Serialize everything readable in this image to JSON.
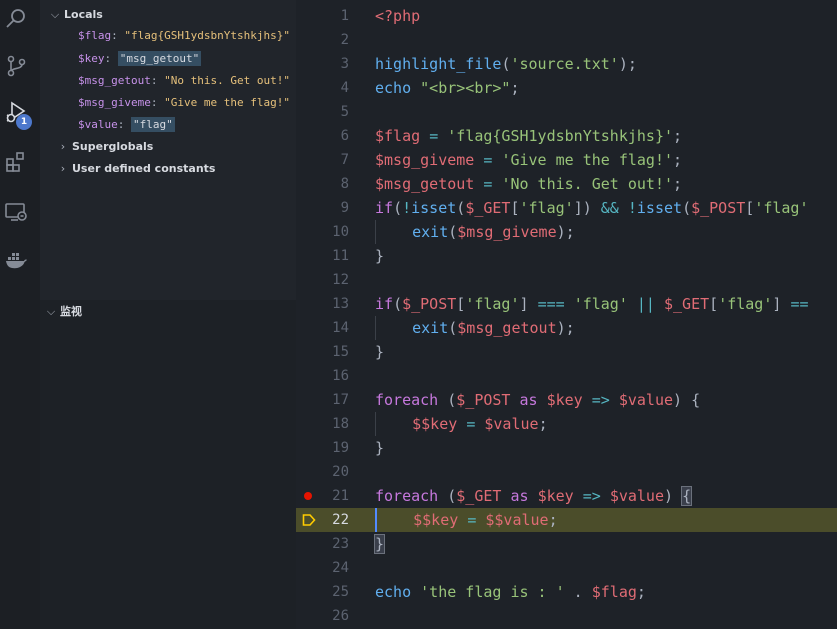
{
  "activity_bar": {
    "icons": [
      "search-icon",
      "source-control-icon",
      "run-debug-icon",
      "extensions-icon",
      "remote-explorer-icon",
      "docker-icon"
    ],
    "debug_badge": "1"
  },
  "sidebar": {
    "locals_label": "Locals",
    "locals": [
      {
        "name": "$flag",
        "value": "\"flag{GSH1ydsbnYtshkjhs}\"",
        "highlight": false
      },
      {
        "name": "$key",
        "value": "\"msg_getout\"",
        "highlight": true
      },
      {
        "name": "$msg_getout",
        "value": "\"No this. Get out!\"",
        "highlight": false
      },
      {
        "name": "$msg_giveme",
        "value": "\"Give me the flag!\"",
        "highlight": false
      },
      {
        "name": "$value",
        "value": "\"flag\"",
        "highlight": true
      }
    ],
    "superglobals_label": "Superglobals",
    "constants_label": "User defined constants",
    "watch_label": "监视"
  },
  "editor": {
    "breakpoint_line": 21,
    "current_line": 22,
    "line_numbers": [
      "1",
      "2",
      "3",
      "4",
      "5",
      "6",
      "7",
      "8",
      "9",
      "10",
      "11",
      "12",
      "13",
      "14",
      "15",
      "16",
      "17",
      "18",
      "19",
      "20",
      "21",
      "22",
      "23",
      "24",
      "25",
      "26"
    ],
    "lines": [
      [
        [
          "tag",
          "<?php"
        ]
      ],
      [],
      [
        [
          "fn",
          "highlight_file"
        ],
        [
          "pt",
          "("
        ],
        [
          "str",
          "'source.txt'"
        ],
        [
          "pt",
          ");"
        ]
      ],
      [
        [
          "fn",
          "echo"
        ],
        [
          "pt",
          " "
        ],
        [
          "str",
          "\"<br><br>\""
        ],
        [
          "pt",
          ";"
        ]
      ],
      [],
      [
        [
          "var",
          "$flag"
        ],
        [
          "pt",
          " "
        ],
        [
          "op",
          "="
        ],
        [
          "pt",
          " "
        ],
        [
          "str",
          "'flag{GSH1ydsbnYtshkjhs}'"
        ],
        [
          "pt",
          ";"
        ]
      ],
      [
        [
          "var",
          "$msg_giveme"
        ],
        [
          "pt",
          " "
        ],
        [
          "op",
          "="
        ],
        [
          "pt",
          " "
        ],
        [
          "str",
          "'Give me the flag!'"
        ],
        [
          "pt",
          ";"
        ]
      ],
      [
        [
          "var",
          "$msg_getout"
        ],
        [
          "pt",
          " "
        ],
        [
          "op",
          "="
        ],
        [
          "pt",
          " "
        ],
        [
          "str",
          "'No this. Get out!'"
        ],
        [
          "pt",
          ";"
        ]
      ],
      [
        [
          "kw",
          "if"
        ],
        [
          "pt",
          "("
        ],
        [
          "op",
          "!"
        ],
        [
          "fn",
          "isset"
        ],
        [
          "pt",
          "("
        ],
        [
          "var",
          "$_GET"
        ],
        [
          "pt",
          "["
        ],
        [
          "str",
          "'flag'"
        ],
        [
          "pt",
          "]) "
        ],
        [
          "op",
          "&&"
        ],
        [
          "pt",
          " "
        ],
        [
          "op",
          "!"
        ],
        [
          "fn",
          "isset"
        ],
        [
          "pt",
          "("
        ],
        [
          "var",
          "$_POST"
        ],
        [
          "pt",
          "["
        ],
        [
          "str",
          "'flag'"
        ]
      ],
      [
        [
          "ind",
          "    "
        ],
        [
          "fn",
          "exit"
        ],
        [
          "pt",
          "("
        ],
        [
          "var",
          "$msg_giveme"
        ],
        [
          "pt",
          ");"
        ]
      ],
      [
        [
          "pt",
          "}"
        ]
      ],
      [],
      [
        [
          "kw",
          "if"
        ],
        [
          "pt",
          "("
        ],
        [
          "var",
          "$_POST"
        ],
        [
          "pt",
          "["
        ],
        [
          "str",
          "'flag'"
        ],
        [
          "pt",
          "] "
        ],
        [
          "op",
          "==="
        ],
        [
          "pt",
          " "
        ],
        [
          "str",
          "'flag'"
        ],
        [
          "pt",
          " "
        ],
        [
          "op",
          "||"
        ],
        [
          "pt",
          " "
        ],
        [
          "var",
          "$_GET"
        ],
        [
          "pt",
          "["
        ],
        [
          "str",
          "'flag'"
        ],
        [
          "pt",
          "] "
        ],
        [
          "op",
          "=="
        ]
      ],
      [
        [
          "ind",
          "    "
        ],
        [
          "fn",
          "exit"
        ],
        [
          "pt",
          "("
        ],
        [
          "var",
          "$msg_getout"
        ],
        [
          "pt",
          ");"
        ]
      ],
      [
        [
          "pt",
          "}"
        ]
      ],
      [],
      [
        [
          "kw",
          "foreach"
        ],
        [
          "pt",
          " ("
        ],
        [
          "var",
          "$_POST"
        ],
        [
          "pt",
          " "
        ],
        [
          "kw",
          "as"
        ],
        [
          "pt",
          " "
        ],
        [
          "var",
          "$key"
        ],
        [
          "pt",
          " "
        ],
        [
          "op",
          "=>"
        ],
        [
          "pt",
          " "
        ],
        [
          "var",
          "$value"
        ],
        [
          "pt",
          ") {"
        ]
      ],
      [
        [
          "ind",
          "    "
        ],
        [
          "var",
          "$$key"
        ],
        [
          "pt",
          " "
        ],
        [
          "op",
          "="
        ],
        [
          "pt",
          " "
        ],
        [
          "var",
          "$value"
        ],
        [
          "pt",
          ";"
        ]
      ],
      [
        [
          "pt",
          "}"
        ]
      ],
      [],
      [
        [
          "kw",
          "foreach"
        ],
        [
          "pt",
          " ("
        ],
        [
          "var",
          "$_GET"
        ],
        [
          "pt",
          " "
        ],
        [
          "kw",
          "as"
        ],
        [
          "pt",
          " "
        ],
        [
          "var",
          "$key"
        ],
        [
          "pt",
          " "
        ],
        [
          "op",
          "=>"
        ],
        [
          "pt",
          " "
        ],
        [
          "var",
          "$value"
        ],
        [
          "pt",
          ") "
        ],
        [
          "bh",
          "{"
        ]
      ],
      [
        [
          "cur",
          "    "
        ],
        [
          "var",
          "$$key"
        ],
        [
          "pt",
          " "
        ],
        [
          "op",
          "="
        ],
        [
          "pt",
          " "
        ],
        [
          "var",
          "$$value"
        ],
        [
          "pt",
          ";"
        ]
      ],
      [
        [
          "bh",
          "}"
        ]
      ],
      [],
      [
        [
          "fn",
          "echo"
        ],
        [
          "pt",
          " "
        ],
        [
          "str",
          "'the flag is : '"
        ],
        [
          "pt",
          " . "
        ],
        [
          "var",
          "$flag"
        ],
        [
          "pt",
          ";"
        ]
      ],
      []
    ]
  }
}
